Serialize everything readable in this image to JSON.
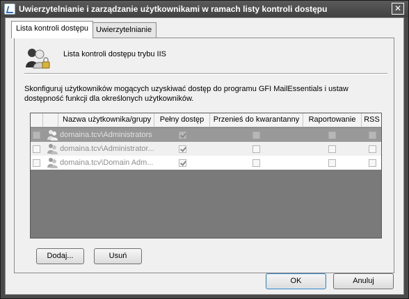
{
  "window": {
    "title": "Uwierzytelnianie i zarządzanie użytkownikami w ramach listy kontroli dostępu",
    "close_symbol": "✕"
  },
  "tabs": [
    {
      "label": "Lista kontroli dostępu",
      "active": true
    },
    {
      "label": "Uwierzytelnianie",
      "active": false
    }
  ],
  "panel": {
    "header_icon": "users-lock-icon",
    "header_title": "Lista kontroli dostępu trybu IIS",
    "description": "Skonfiguruj użytkowników mogących uzyskiwać dostęp do programu GFI MailEssentials i ustaw dostępność funkcji dla określonych użytkowników."
  },
  "list": {
    "columns": [
      "",
      "Nazwa użytkownika/grupy",
      "Pełny dostęp",
      "Przenieś do kwarantanny",
      "Raportowanie",
      "RSS"
    ],
    "rows": [
      {
        "name": "domaina.tcv\\Administrators",
        "full_access": true,
        "quarantine": false,
        "reporting": false,
        "rss": false,
        "selected": true
      },
      {
        "name": "domaina.tcv\\Administrator...",
        "full_access": true,
        "quarantine": false,
        "reporting": false,
        "rss": false,
        "selected": false
      },
      {
        "name": "domaina.tcv\\Domain Adm...",
        "full_access": true,
        "quarantine": false,
        "reporting": false,
        "rss": false,
        "selected": false
      }
    ]
  },
  "buttons": {
    "add": "Dodaj...",
    "remove": "Usuń",
    "ok": "OK",
    "cancel": "Anuluj"
  }
}
